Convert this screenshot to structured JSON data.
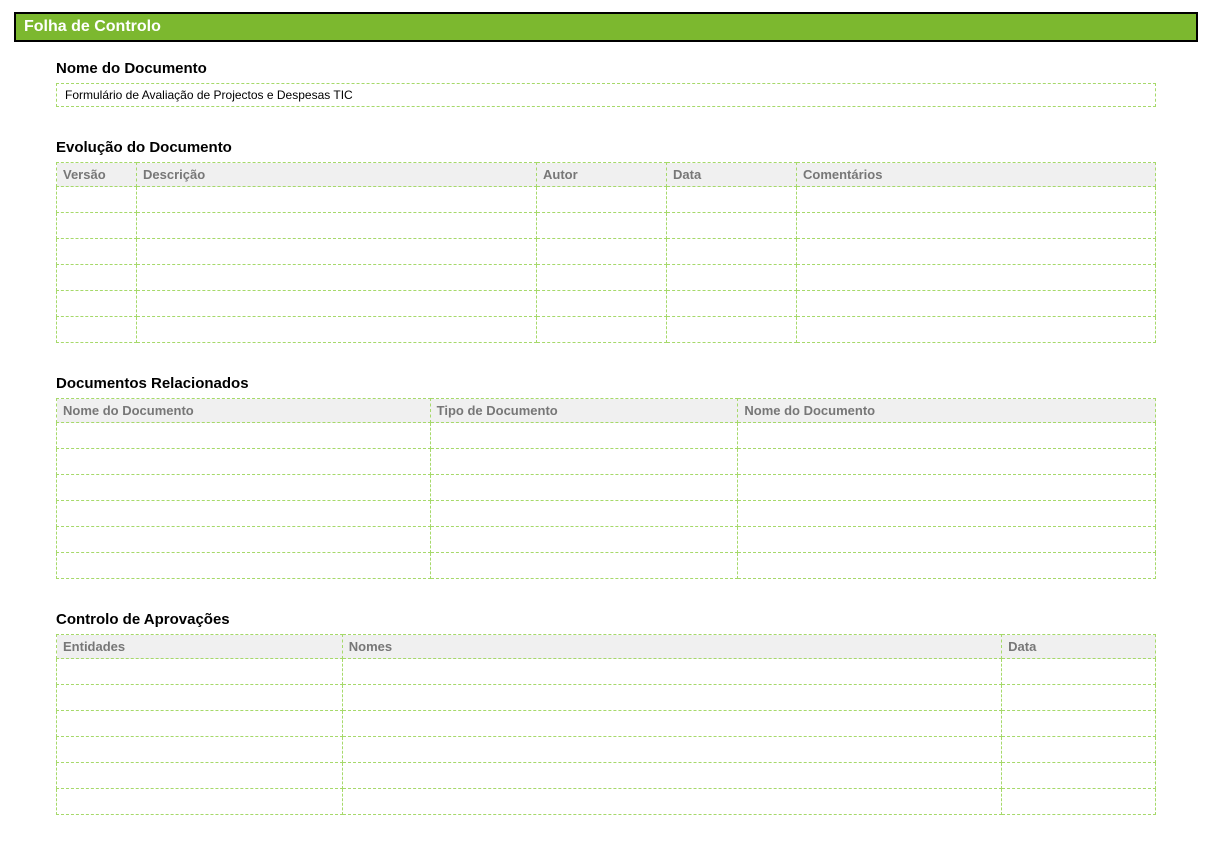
{
  "header": {
    "title": "Folha de Controlo"
  },
  "doc_name": {
    "label": "Nome do Documento",
    "value": "Formulário de Avaliação de Projectos e Despesas TIC"
  },
  "evolucao": {
    "label": "Evolução do Documento",
    "columns": [
      "Versão",
      "Descrição",
      "Autor",
      "Data",
      "Comentários"
    ],
    "rows": [
      [
        "",
        "",
        "",
        "",
        ""
      ],
      [
        "",
        "",
        "",
        "",
        ""
      ],
      [
        "",
        "",
        "",
        "",
        ""
      ],
      [
        "",
        "",
        "",
        "",
        ""
      ],
      [
        "",
        "",
        "",
        "",
        ""
      ],
      [
        "",
        "",
        "",
        "",
        ""
      ]
    ]
  },
  "related": {
    "label": "Documentos Relacionados",
    "columns": [
      "Nome do Documento",
      "Tipo de Documento",
      "Nome do Documento"
    ],
    "rows": [
      [
        "",
        "",
        ""
      ],
      [
        "",
        "",
        ""
      ],
      [
        "",
        "",
        ""
      ],
      [
        "",
        "",
        ""
      ],
      [
        "",
        "",
        ""
      ],
      [
        "",
        "",
        ""
      ]
    ]
  },
  "approvals": {
    "label": "Controlo de Aprovações",
    "columns": [
      "Entidades",
      "Nomes",
      "Data"
    ],
    "rows": [
      [
        "",
        "",
        ""
      ],
      [
        "",
        "",
        ""
      ],
      [
        "",
        "",
        ""
      ],
      [
        "",
        "",
        ""
      ],
      [
        "",
        "",
        ""
      ],
      [
        "",
        "",
        ""
      ]
    ]
  }
}
